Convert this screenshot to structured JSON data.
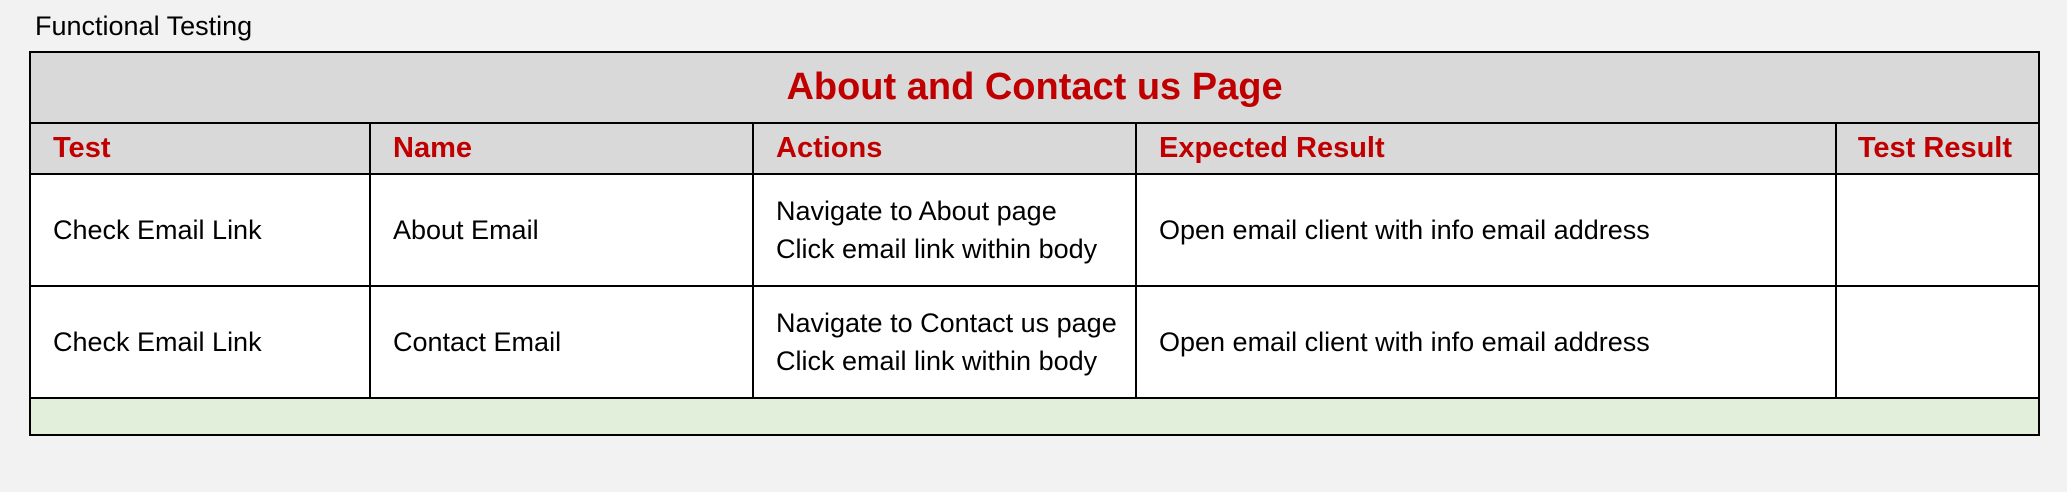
{
  "section_label": "Functional Testing",
  "table": {
    "title": "About and Contact us Page",
    "columns": {
      "test": "Test",
      "name": "Name",
      "actions": "Actions",
      "expected": "Expected Result",
      "result": "Test Result"
    },
    "rows": [
      {
        "test": "Check Email Link",
        "name": "About Email",
        "actions": [
          "Navigate to About page",
          "Click email link within body"
        ],
        "expected": "Open email client with info email address",
        "result": ""
      },
      {
        "test": "Check Email Link",
        "name": "Contact Email",
        "actions": [
          "Navigate to Contact us page",
          "Click email link within body"
        ],
        "expected": "Open email client with info email address",
        "result": ""
      }
    ]
  },
  "colors": {
    "header_text": "#c00000",
    "header_bg": "#d9d9d9",
    "footer_bg": "#e2efda",
    "page_bg": "#f2f2f2"
  }
}
